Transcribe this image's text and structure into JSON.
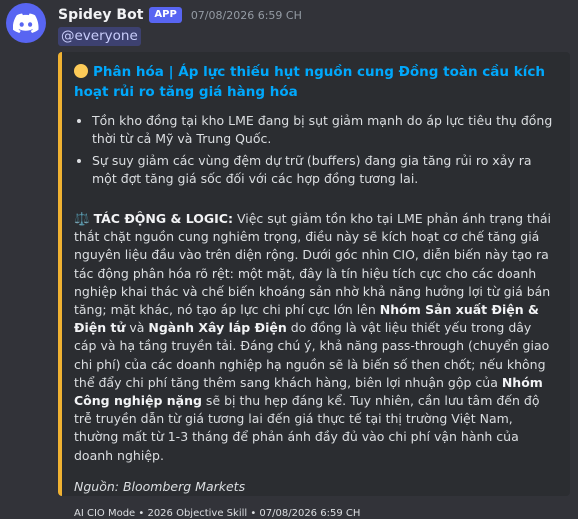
{
  "message": {
    "username": "Spidey Bot",
    "badge": "APP",
    "timestamp": "07/08/2026 6:59 CH",
    "mention": "@everyone"
  },
  "embed": {
    "accent_color": "#f0b232",
    "title_icon": "yellow-circle-icon",
    "title": "Phân hóa | Áp lực thiếu hụt nguồn cung Đồng toàn cầu kích hoạt rủi ro tăng giá hàng hóa",
    "bullets": [
      "Tồn kho đồng tại kho LME đang bị sụt giảm mạnh do áp lực tiêu thụ đồng thời từ cả Mỹ và Trung Quốc.",
      "Sự suy giảm các vùng đệm dự trữ (buffers) đang gia tăng rủi ro xảy ra một đợt tăng giá sốc đối với các hợp đồng tương lai."
    ],
    "impact": {
      "icon": "balance-scale-icon",
      "label": "TÁC ĐỘNG & LOGIC:",
      "part1": " Việc sụt giảm tồn kho tại LME phản ánh trạng thái thắt chặt nguồn cung nghiêm trọng, điều này sẽ kích hoạt cơ chế tăng giá nguyên liệu đầu vào trên diện rộng. Dưới góc nhìn CIO, diễn biến này tạo ra tác động phân hóa rõ rệt: một mặt, đây là tín hiệu tích cực cho các doanh nghiệp khai thác và chế biến khoáng sản nhờ khả năng hưởng lợi từ giá bán tăng; mặt khác, nó tạo áp lực chi phí cực lớn lên ",
      "bold1": "Nhóm Sản xuất Điện & Điện tử",
      "part2": " và ",
      "bold2": "Ngành Xây lắp Điện",
      "part3": " do đồng là vật liệu thiết yếu trong dây cáp và hạ tầng truyền tải. Đáng chú ý, khả năng pass-through (chuyển giao chi phí) của các doanh nghiệp hạ nguồn sẽ là biến số then chốt; nếu không thể đẩy chi phí tăng thêm sang khách hàng, biên lợi nhuận gộp của ",
      "bold3": "Nhóm Công nghiệp nặng",
      "part4": " sẽ bị thu hẹp đáng kể. Tuy nhiên, cần lưu tâm đến độ trễ truyền dẫn từ giá tương lai đến giá thực tế tại thị trường Việt Nam, thường mất từ 1-3 tháng để phản ánh đầy đủ vào chi phí vận hành của doanh nghiệp."
    },
    "source": "Nguồn: Bloomberg Markets",
    "footer": "AI CIO Mode • 2026 Objective Skill • 07/08/2026 6:59 CH"
  }
}
